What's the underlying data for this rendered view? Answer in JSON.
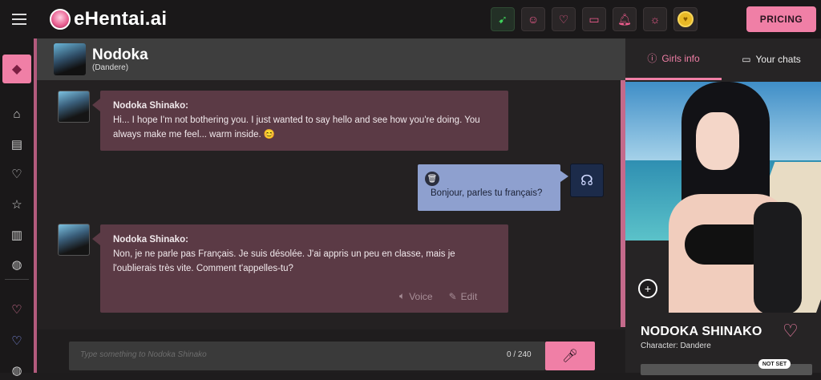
{
  "app": {
    "name": "eHentai.ai"
  },
  "topbar": {
    "pricing_label": "PRICING"
  },
  "chat": {
    "name": "Nodoka",
    "subtitle": "(Dandere)",
    "messages": [
      {
        "sender": "Nodoka Shinako:",
        "text": "Hi... I hope I'm not bothering you. I just wanted to say hello and see how you're doing. You always make me feel... warm inside. 😊"
      },
      {
        "sender": "user",
        "text": "Bonjour, parles tu français?"
      },
      {
        "sender": "Nodoka Shinako:",
        "text": "Non, je ne parle pas Français. Je suis désolée. J'ai appris un peu en classe, mais je l'oublierais très vite. Comment t'appelles-tu?"
      }
    ],
    "actions": {
      "voice": "Voice",
      "edit": "Edit"
    },
    "input": {
      "placeholder": "Type something to Nodoka Shinako",
      "counter": "0 / 240"
    }
  },
  "right_panel": {
    "tabs": [
      {
        "label": "Girls info"
      },
      {
        "label": "Your chats"
      }
    ],
    "character_name": "NODOKA SHINAKO",
    "character_type": "Character: Dandere",
    "badge": "NOT SET"
  },
  "colors": {
    "accent": "#f07fa6",
    "ai_bubble": "#5b3a45",
    "user_bubble": "#8ea0cf"
  },
  "icons": [
    "menu-icon",
    "speed-icon",
    "user-icon",
    "heart-icon",
    "chat-icon",
    "bell-icon",
    "sun-icon",
    "coin-icon",
    "gem-icon",
    "home-icon",
    "message-icon",
    "star-icon",
    "chart-icon",
    "globe-icon",
    "trash-icon",
    "speaker-icon",
    "edit-icon",
    "mic-icon",
    "zoom-icon"
  ]
}
